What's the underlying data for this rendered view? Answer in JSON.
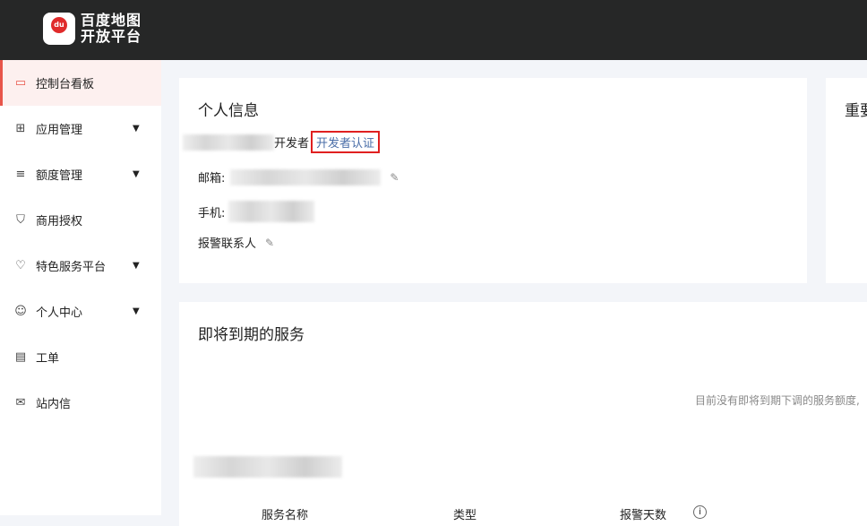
{
  "brand": {
    "line1": "百度地图",
    "line2": "开放平台",
    "pin": "du"
  },
  "sidebar": {
    "items": [
      {
        "label": "控制台看板",
        "icon": "id-card-icon",
        "active": true,
        "expandable": false
      },
      {
        "label": "应用管理",
        "icon": "grid-icon",
        "expandable": true
      },
      {
        "label": "额度管理",
        "icon": "sliders-icon",
        "expandable": true
      },
      {
        "label": "商用授权",
        "icon": "shield-icon",
        "expandable": false
      },
      {
        "label": "特色服务平台",
        "icon": "heart-icon",
        "expandable": true
      },
      {
        "label": "个人中心",
        "icon": "user-icon",
        "expandable": true
      },
      {
        "label": "工单",
        "icon": "clipboard-icon",
        "expandable": false
      },
      {
        "label": "站内信",
        "icon": "mail-icon",
        "expandable": false
      }
    ]
  },
  "profile": {
    "title": "个人信息",
    "developer_suffix": "开发者",
    "verify_link": "开发者认证",
    "email_label": "邮箱:",
    "phone_label": "手机:",
    "alert_contact_label": "报警联系人"
  },
  "right_card": {
    "title": "重要"
  },
  "expiring": {
    "title": "即将到期的服务",
    "empty_text": "目前没有即将到期下调的服务额度,",
    "columns": [
      "服务名称",
      "类型",
      "报警天数"
    ]
  },
  "colors": {
    "accent": "#e8554a",
    "link": "#4a6ea8",
    "highlight_box": "#e02020"
  }
}
